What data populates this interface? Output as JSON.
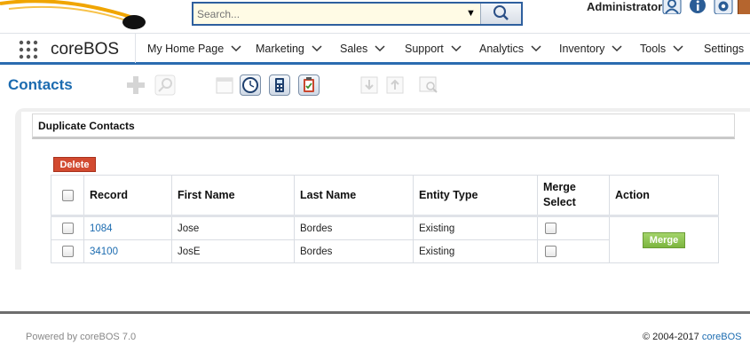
{
  "search": {
    "placeholder": "Search..."
  },
  "user": {
    "name": "Administrator"
  },
  "app": {
    "name": "coreBOS"
  },
  "nav": {
    "items": [
      {
        "label": "My Home Page"
      },
      {
        "label": "Marketing"
      },
      {
        "label": "Sales"
      },
      {
        "label": "Support"
      },
      {
        "label": "Analytics"
      },
      {
        "label": "Inventory"
      },
      {
        "label": "Tools"
      },
      {
        "label": "Settings"
      }
    ]
  },
  "module": {
    "title": "Contacts"
  },
  "panel": {
    "title": "Duplicate Contacts",
    "delete_label": "Delete",
    "merge_label": "Merge"
  },
  "table": {
    "headers": {
      "record": "Record",
      "first_name": "First Name",
      "last_name": "Last Name",
      "entity_type": "Entity Type",
      "merge_select_1": "Merge",
      "merge_select_2": "Select",
      "action": "Action"
    },
    "rows": [
      {
        "record": "1084",
        "first_name": "Jose",
        "last_name": "Bordes",
        "entity_type": "Existing"
      },
      {
        "record": "34100",
        "first_name": "JosE",
        "last_name": "Bordes",
        "entity_type": "Existing"
      }
    ]
  },
  "footer": {
    "powered": "Powered by coreBOS 7.0",
    "copyright": "© 2004-2017 ",
    "brand": "coreBOS"
  },
  "colors": {
    "accent": "#1b6bb0",
    "nav_underline": "#2b6cb0",
    "delete": "#d24a30",
    "merge": "#7cb53f",
    "search_bg": "#fffbe5"
  }
}
